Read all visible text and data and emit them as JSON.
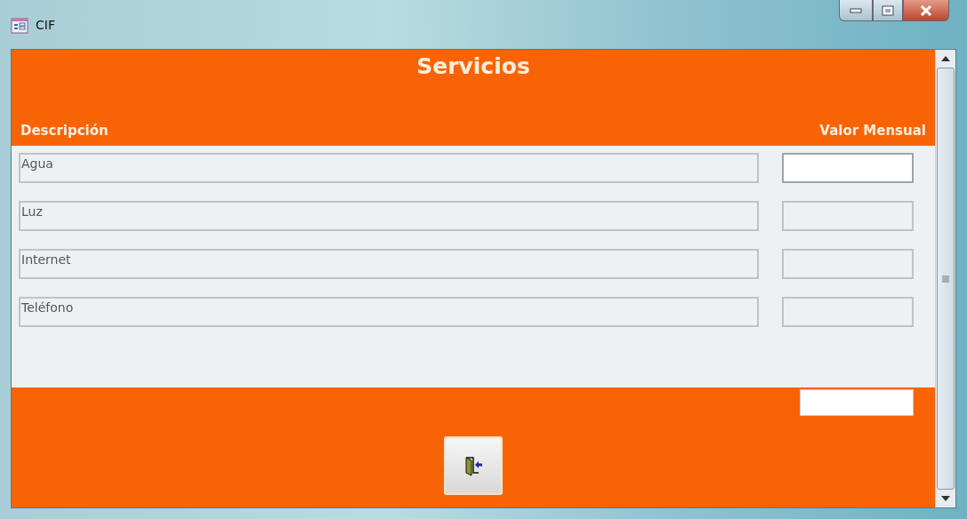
{
  "window": {
    "title": "CIF"
  },
  "form": {
    "title": "Servicios",
    "columns": [
      "Descripción",
      "Valor Mensual"
    ],
    "rows": [
      {
        "description": "Agua",
        "focused": true
      },
      {
        "description": "Luz",
        "focused": false
      },
      {
        "description": "Internet",
        "focused": false
      },
      {
        "description": "Teléfono",
        "focused": false
      }
    ]
  }
}
